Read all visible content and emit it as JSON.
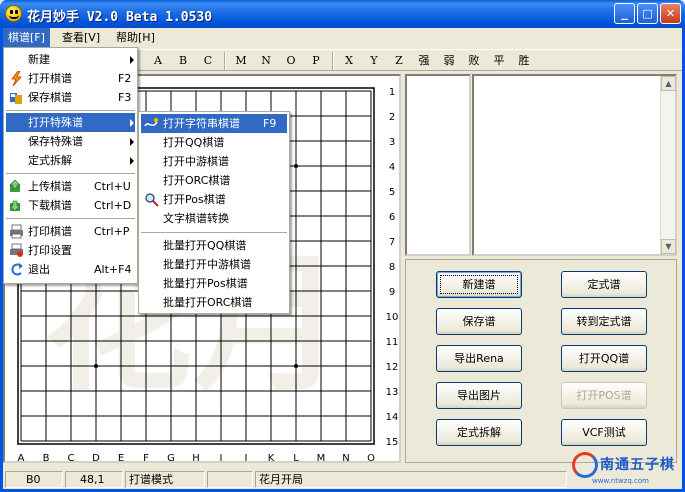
{
  "window": {
    "title": "花月妙手  V2.0 Beta 1.0530",
    "minimize": "_",
    "maximize": "□",
    "close": "✕"
  },
  "menubar": [
    "棋谱[F]",
    "查看[V]",
    "帮助[H]"
  ],
  "toolbar": {
    "letters": [
      "A",
      "B",
      "C",
      "M",
      "N",
      "O",
      "P",
      "X",
      "Y",
      "Z"
    ],
    "words": [
      "强",
      "弱",
      "败",
      "平",
      "胜"
    ]
  },
  "file_menu": {
    "items": [
      {
        "label": "新建",
        "shortcut": "",
        "submenu": true,
        "icon": ""
      },
      {
        "label": "打开棋谱",
        "shortcut": "F2",
        "submenu": false,
        "icon": "lightning-icon"
      },
      {
        "label": "保存棋谱",
        "shortcut": "F3",
        "submenu": false,
        "icon": "save-icon"
      },
      {
        "label": "打开特殊谱",
        "shortcut": "",
        "submenu": true,
        "icon": ""
      },
      {
        "label": "保存特殊谱",
        "shortcut": "",
        "submenu": true,
        "icon": ""
      },
      {
        "label": "定式拆解",
        "shortcut": "",
        "submenu": true,
        "icon": ""
      },
      {
        "label": "上传棋谱",
        "shortcut": "Ctrl+U",
        "submenu": false,
        "icon": "upload-icon"
      },
      {
        "label": "下载棋谱",
        "shortcut": "Ctrl+D",
        "submenu": false,
        "icon": "download-icon"
      },
      {
        "label": "打印棋谱",
        "shortcut": "Ctrl+P",
        "submenu": false,
        "icon": "printer-icon"
      },
      {
        "label": "打印设置",
        "shortcut": "",
        "submenu": false,
        "icon": "print-setup-icon"
      },
      {
        "label": "退出",
        "shortcut": "Alt+F4",
        "submenu": false,
        "icon": "exit-icon"
      }
    ]
  },
  "submenu": {
    "items": [
      {
        "label": "打开字符串棋谱",
        "shortcut": "F9",
        "icon": "string-icon"
      },
      {
        "label": "打开QQ棋谱",
        "shortcut": "",
        "icon": ""
      },
      {
        "label": "打开中游棋谱",
        "shortcut": "",
        "icon": ""
      },
      {
        "label": "打开ORC棋谱",
        "shortcut": "",
        "icon": ""
      },
      {
        "label": "打开Pos棋谱",
        "shortcut": "",
        "icon": "magnifier-icon"
      },
      {
        "label": "文字棋谱转换",
        "shortcut": "",
        "icon": ""
      },
      {
        "label": "批量打开QQ棋谱",
        "shortcut": "",
        "icon": ""
      },
      {
        "label": "批量打开中游棋谱",
        "shortcut": "",
        "icon": ""
      },
      {
        "label": "批量打开Pos棋谱",
        "shortcut": "",
        "icon": ""
      },
      {
        "label": "批量打开ORC棋谱",
        "shortcut": "",
        "icon": ""
      }
    ]
  },
  "board": {
    "cols": [
      "A",
      "B",
      "C",
      "D",
      "E",
      "F",
      "G",
      "H",
      "I",
      "J",
      "K",
      "L",
      "M",
      "N",
      "O"
    ],
    "rows": [
      "1",
      "2",
      "3",
      "4",
      "5",
      "6",
      "7",
      "8",
      "9",
      "10",
      "11",
      "12",
      "13",
      "14",
      "15"
    ],
    "watermark": "花月"
  },
  "buttons": [
    {
      "label": "新建谱",
      "disabled": false
    },
    {
      "label": "定式谱",
      "disabled": false
    },
    {
      "label": "保存谱",
      "disabled": false
    },
    {
      "label": "转到定式谱",
      "disabled": false
    },
    {
      "label": "导出Rena",
      "disabled": false
    },
    {
      "label": "打开QQ谱",
      "disabled": false
    },
    {
      "label": "导出图片",
      "disabled": false
    },
    {
      "label": "打开POS谱",
      "disabled": true
    },
    {
      "label": "定式拆解",
      "disabled": false
    },
    {
      "label": "VCF测试",
      "disabled": false
    }
  ],
  "statusbar": {
    "pos": "B0",
    "coord": "48,1",
    "mode": "打谱模式",
    "empty": "",
    "opening": "花月开局"
  },
  "logo": {
    "cn": "南通五子棋",
    "url": "www.ntwzq.com"
  },
  "colors": {
    "title_blue": "#0054e3",
    "highlight": "#316ac5",
    "face": "#ece9d8"
  }
}
